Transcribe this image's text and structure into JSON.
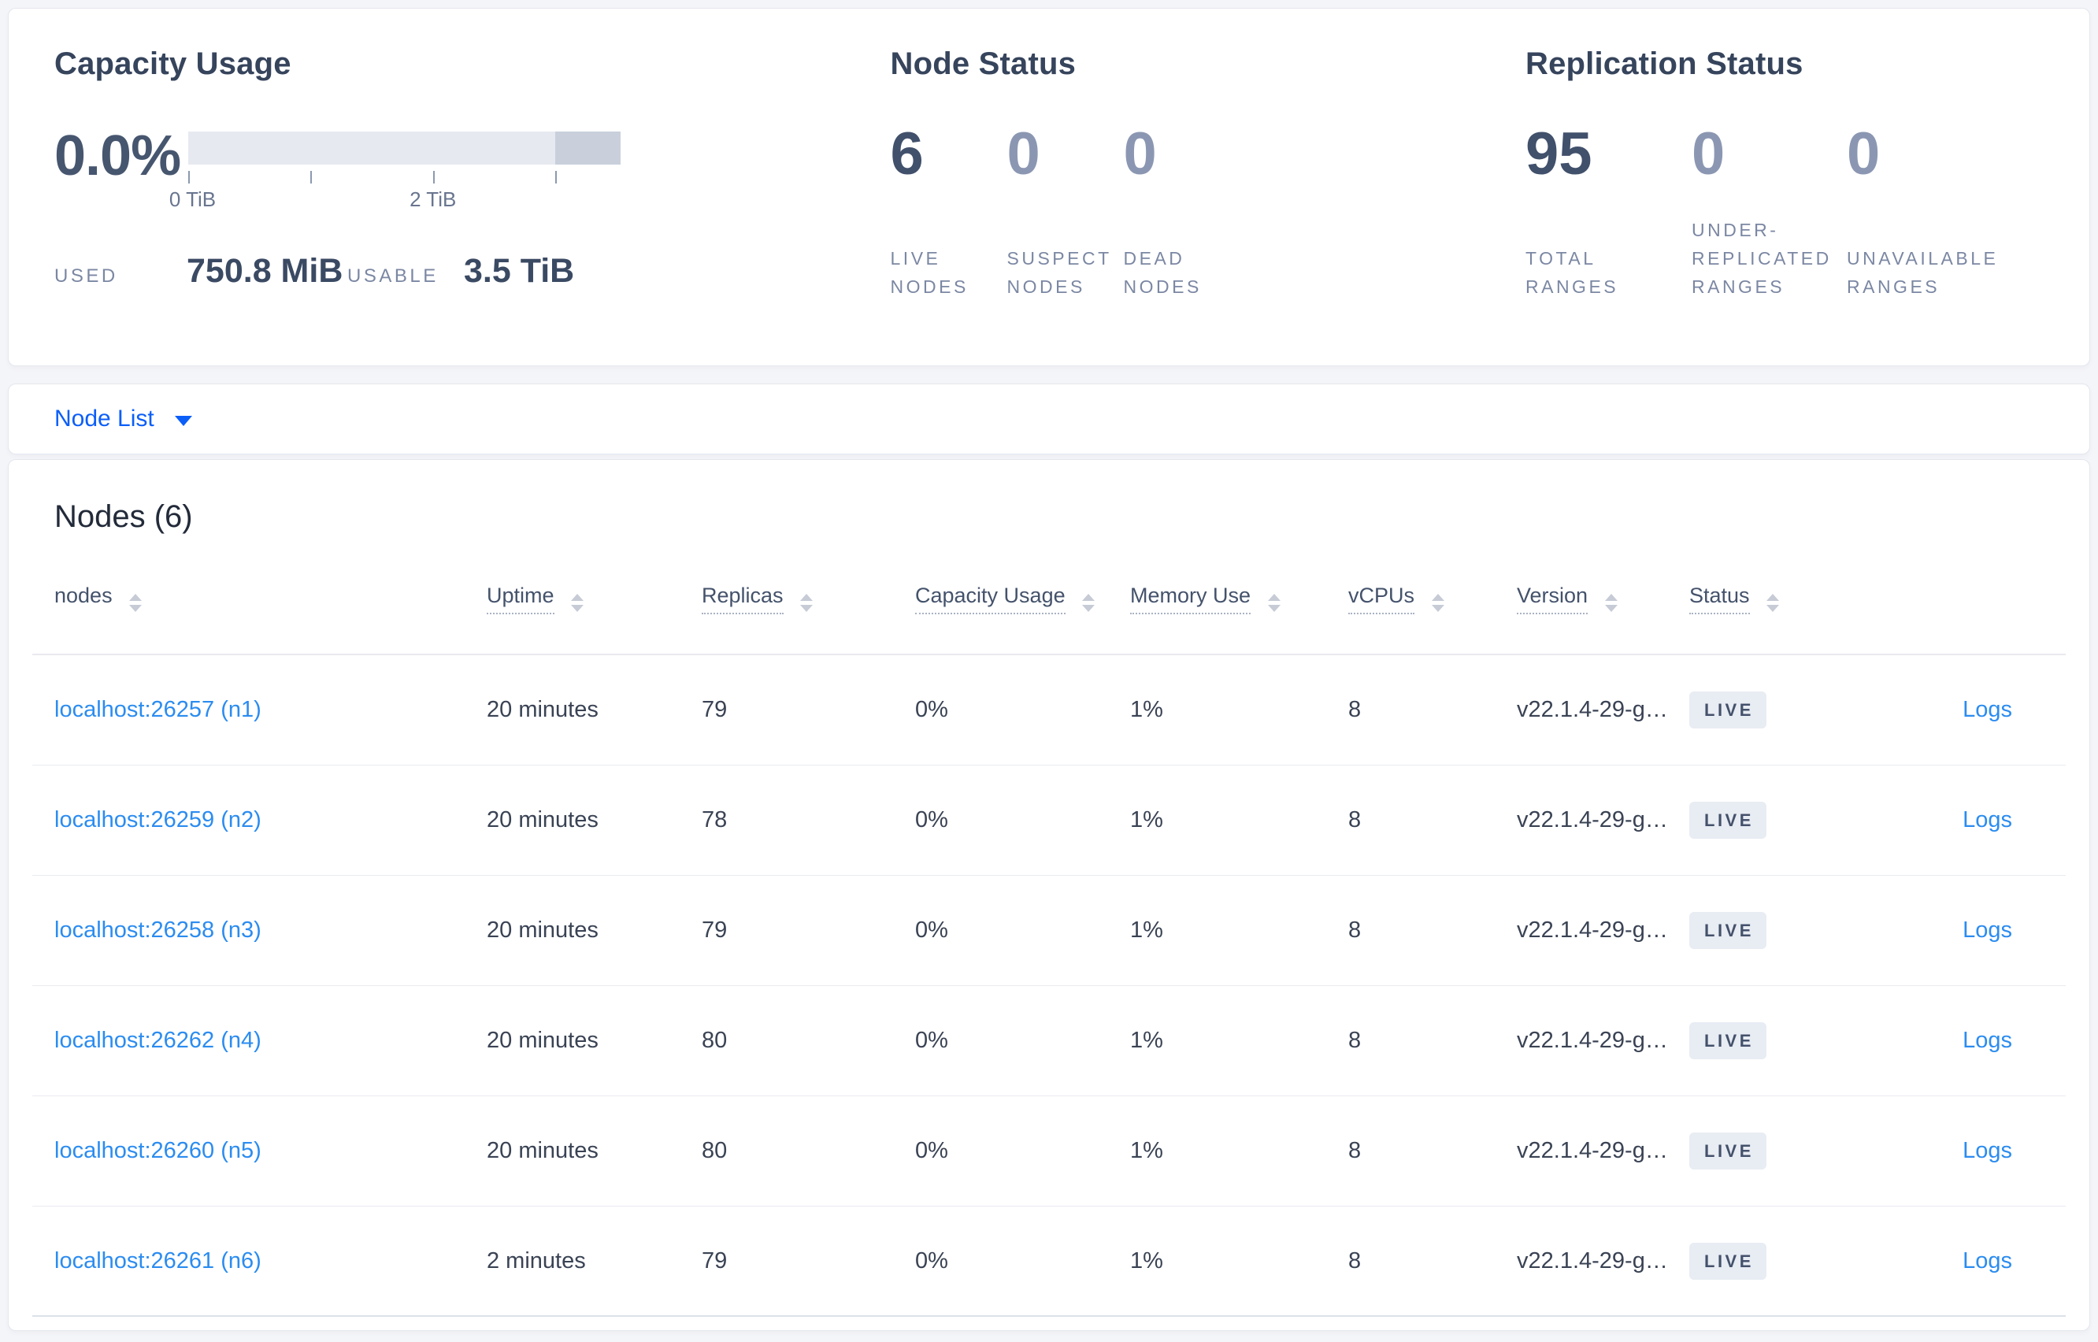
{
  "summary_card": {
    "capacity": {
      "title": "Capacity Usage",
      "percent": "0.0%",
      "bar": {
        "tick_labels": [
          "0 TiB",
          "2 TiB"
        ],
        "axis_ticks_tib": [
          0,
          1,
          2,
          3
        ],
        "usable_tib": 3.5,
        "used_fraction": 0.0
      },
      "used_label": "USED",
      "used_value": "750.8 MiB",
      "usable_label": "USABLE",
      "usable_value": "3.5 TiB"
    },
    "node_status": {
      "title": "Node Status",
      "stats": [
        {
          "value": "6",
          "label": "LIVE\nNODES"
        },
        {
          "value": "0",
          "label": "SUSPECT\nNODES"
        },
        {
          "value": "0",
          "label": "DEAD\nNODES"
        }
      ]
    },
    "replication_status": {
      "title": "Replication Status",
      "stats": [
        {
          "value": "95",
          "label": "TOTAL\nRANGES"
        },
        {
          "value": "0",
          "label": "UNDER-\nREPLICATED\nRANGES"
        },
        {
          "value": "0",
          "label": "UNAVAILABLE\nRANGES"
        }
      ]
    }
  },
  "view_selector": {
    "label": "Node List",
    "caret_icon": "caret-down"
  },
  "nodes_table": {
    "heading": "Nodes (6)",
    "columns": [
      {
        "label": "nodes",
        "sort_icon": "sort-arrows"
      },
      {
        "label": "Uptime",
        "sort_icon": "sort-arrows"
      },
      {
        "label": "Replicas",
        "sort_icon": "sort-arrows"
      },
      {
        "label": "Capacity Usage",
        "sort_icon": "sort-arrows"
      },
      {
        "label": "Memory Use",
        "sort_icon": "sort-arrows"
      },
      {
        "label": "vCPUs",
        "sort_icon": "sort-arrows"
      },
      {
        "label": "Version",
        "sort_icon": "sort-arrows"
      },
      {
        "label": "Status",
        "sort_icon": "sort-arrows"
      }
    ],
    "logs_label": "Logs",
    "rows": [
      {
        "node": "localhost:26257 (n1)",
        "uptime": "20 minutes",
        "replicas": "79",
        "capacity": "0%",
        "memory": "1%",
        "vcpus": "8",
        "version": "v22.1.4-29-g…",
        "status": "LIVE"
      },
      {
        "node": "localhost:26259 (n2)",
        "uptime": "20 minutes",
        "replicas": "78",
        "capacity": "0%",
        "memory": "1%",
        "vcpus": "8",
        "version": "v22.1.4-29-g…",
        "status": "LIVE"
      },
      {
        "node": "localhost:26258 (n3)",
        "uptime": "20 minutes",
        "replicas": "79",
        "capacity": "0%",
        "memory": "1%",
        "vcpus": "8",
        "version": "v22.1.4-29-g…",
        "status": "LIVE"
      },
      {
        "node": "localhost:26262 (n4)",
        "uptime": "20 minutes",
        "replicas": "80",
        "capacity": "0%",
        "memory": "1%",
        "vcpus": "8",
        "version": "v22.1.4-29-g…",
        "status": "LIVE"
      },
      {
        "node": "localhost:26260 (n5)",
        "uptime": "20 minutes",
        "replicas": "80",
        "capacity": "0%",
        "memory": "1%",
        "vcpus": "8",
        "version": "v22.1.4-29-g…",
        "status": "LIVE"
      },
      {
        "node": "localhost:26261 (n6)",
        "uptime": "2 minutes",
        "replicas": "79",
        "capacity": "0%",
        "memory": "1%",
        "vcpus": "8",
        "version": "v22.1.4-29-g…",
        "status": "LIVE"
      }
    ]
  },
  "colors": {
    "page_background": "#f4f5f9",
    "card_background": "#ffffff",
    "card_border": "#e4e7ee",
    "title_text": "#36445c",
    "stat_number_dark": "#41506b",
    "stat_number_light": "#8b97b2",
    "muted_label": "#7b87a3",
    "bar_background": "#e6e9f0",
    "bar_segment": "#c9d0dc",
    "link_blue": "#2b8cf0",
    "selector_blue": "#0b5ef8",
    "badge_background": "#e8ecf3",
    "badge_text": "#44516b"
  }
}
